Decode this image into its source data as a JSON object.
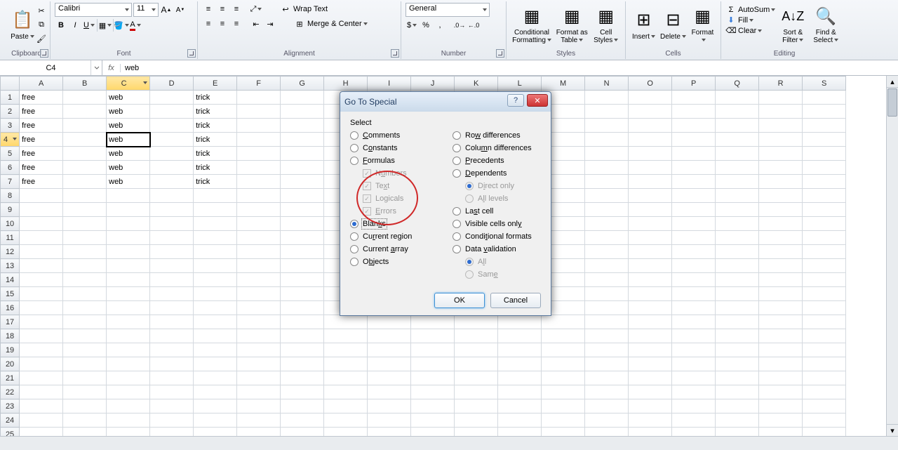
{
  "ribbon": {
    "clipboard": {
      "paste": "Paste",
      "title": "Clipboard"
    },
    "font": {
      "name": "Calibri",
      "size": "11",
      "title": "Font"
    },
    "alignment": {
      "wrap": "Wrap Text",
      "merge": "Merge & Center",
      "title": "Alignment"
    },
    "number": {
      "format": "General",
      "title": "Number"
    },
    "styles": {
      "cond": "Conditional\nFormatting",
      "table": "Format\nas Table",
      "cell": "Cell\nStyles",
      "title": "Styles"
    },
    "cells": {
      "insert": "Insert",
      "delete": "Delete",
      "format": "Format",
      "title": "Cells"
    },
    "editing": {
      "autosum": "AutoSum",
      "fill": "Fill",
      "clear": "Clear",
      "sort": "Sort &\nFilter",
      "find": "Find &\nSelect",
      "title": "Editing"
    }
  },
  "namebox": "C4",
  "formula_fx": "fx",
  "formula": "web",
  "columns": [
    "A",
    "B",
    "C",
    "D",
    "E",
    "F",
    "G",
    "H",
    "I",
    "J",
    "K",
    "L",
    "M",
    "N",
    "O",
    "P",
    "Q",
    "R",
    "S"
  ],
  "active_col": "C",
  "active_row": "4",
  "rows": [
    {
      "n": "1",
      "cells": {
        "A": "free",
        "C": "web",
        "E": "trick"
      }
    },
    {
      "n": "2",
      "cells": {
        "A": "free",
        "C": "web",
        "E": "trick"
      }
    },
    {
      "n": "3",
      "cells": {
        "A": "free",
        "C": "web",
        "E": "trick"
      }
    },
    {
      "n": "4",
      "cells": {
        "A": "free",
        "C": "web",
        "E": "trick"
      }
    },
    {
      "n": "5",
      "cells": {
        "A": "free",
        "C": "web",
        "E": "trick"
      }
    },
    {
      "n": "6",
      "cells": {
        "A": "free",
        "C": "web",
        "E": "trick"
      }
    },
    {
      "n": "7",
      "cells": {
        "A": "free",
        "C": "web",
        "E": "trick"
      }
    },
    {
      "n": "8",
      "cells": {}
    },
    {
      "n": "9",
      "cells": {}
    },
    {
      "n": "10",
      "cells": {}
    },
    {
      "n": "11",
      "cells": {}
    },
    {
      "n": "12",
      "cells": {}
    },
    {
      "n": "13",
      "cells": {}
    },
    {
      "n": "14",
      "cells": {}
    },
    {
      "n": "15",
      "cells": {}
    },
    {
      "n": "16",
      "cells": {}
    },
    {
      "n": "17",
      "cells": {}
    },
    {
      "n": "18",
      "cells": {}
    },
    {
      "n": "19",
      "cells": {}
    },
    {
      "n": "20",
      "cells": {}
    },
    {
      "n": "21",
      "cells": {}
    },
    {
      "n": "22",
      "cells": {}
    },
    {
      "n": "23",
      "cells": {}
    },
    {
      "n": "24",
      "cells": {}
    },
    {
      "n": "25",
      "cells": {}
    }
  ],
  "dialog": {
    "title": "Go To Special",
    "section": "Select",
    "left": [
      {
        "key": "comments",
        "label": "Comments",
        "type": "radio",
        "checked": false,
        "u": "C"
      },
      {
        "key": "constants",
        "label": "Constants",
        "type": "radio",
        "checked": false,
        "u": "o"
      },
      {
        "key": "formulas",
        "label": "Formulas",
        "type": "radio",
        "checked": false,
        "u": "F"
      },
      {
        "key": "numbers",
        "label": "Numbers",
        "type": "check",
        "checked": true,
        "disabled": true,
        "indent": true,
        "u": "u"
      },
      {
        "key": "text",
        "label": "Text",
        "type": "check",
        "checked": true,
        "disabled": true,
        "indent": true,
        "u": "x"
      },
      {
        "key": "logicals",
        "label": "Logicals",
        "type": "check",
        "checked": true,
        "disabled": true,
        "indent": true,
        "u": "g"
      },
      {
        "key": "errors",
        "label": "Errors",
        "type": "check",
        "checked": true,
        "disabled": true,
        "indent": true,
        "u": "E"
      },
      {
        "key": "blanks",
        "label": "Blanks",
        "type": "radio",
        "checked": true,
        "u": "k",
        "dashed": true
      },
      {
        "key": "region",
        "label": "Current region",
        "type": "radio",
        "checked": false,
        "u": "r"
      },
      {
        "key": "array",
        "label": "Current array",
        "type": "radio",
        "checked": false,
        "u": "a"
      },
      {
        "key": "objects",
        "label": "Objects",
        "type": "radio",
        "checked": false,
        "u": "b"
      }
    ],
    "right": [
      {
        "key": "rowdiff",
        "label": "Row differences",
        "type": "radio",
        "checked": false,
        "u": "w"
      },
      {
        "key": "coldiff",
        "label": "Column differences",
        "type": "radio",
        "checked": false,
        "u": "m"
      },
      {
        "key": "precedents",
        "label": "Precedents",
        "type": "radio",
        "checked": false,
        "u": "P"
      },
      {
        "key": "dependents",
        "label": "Dependents",
        "type": "radio",
        "checked": false,
        "u": "D"
      },
      {
        "key": "direct",
        "label": "Direct only",
        "type": "radio",
        "checked": true,
        "disabled": true,
        "indent": true,
        "u": "i"
      },
      {
        "key": "alllevels",
        "label": "All levels",
        "type": "radio",
        "checked": false,
        "disabled": true,
        "indent": true,
        "u": "l"
      },
      {
        "key": "lastcell",
        "label": "Last cell",
        "type": "radio",
        "checked": false,
        "u": "s"
      },
      {
        "key": "visible",
        "label": "Visible cells only",
        "type": "radio",
        "checked": false,
        "u": "y"
      },
      {
        "key": "condfmt",
        "label": "Conditional formats",
        "type": "radio",
        "checked": false,
        "u": "t"
      },
      {
        "key": "dataval",
        "label": "Data validation",
        "type": "radio",
        "checked": false,
        "u": "v"
      },
      {
        "key": "all",
        "label": "All",
        "type": "radio",
        "checked": true,
        "disabled": true,
        "indent": true,
        "u": "l"
      },
      {
        "key": "same",
        "label": "Same",
        "type": "radio",
        "checked": false,
        "disabled": true,
        "indent": true,
        "u": "e"
      }
    ],
    "ok": "OK",
    "cancel": "Cancel"
  }
}
